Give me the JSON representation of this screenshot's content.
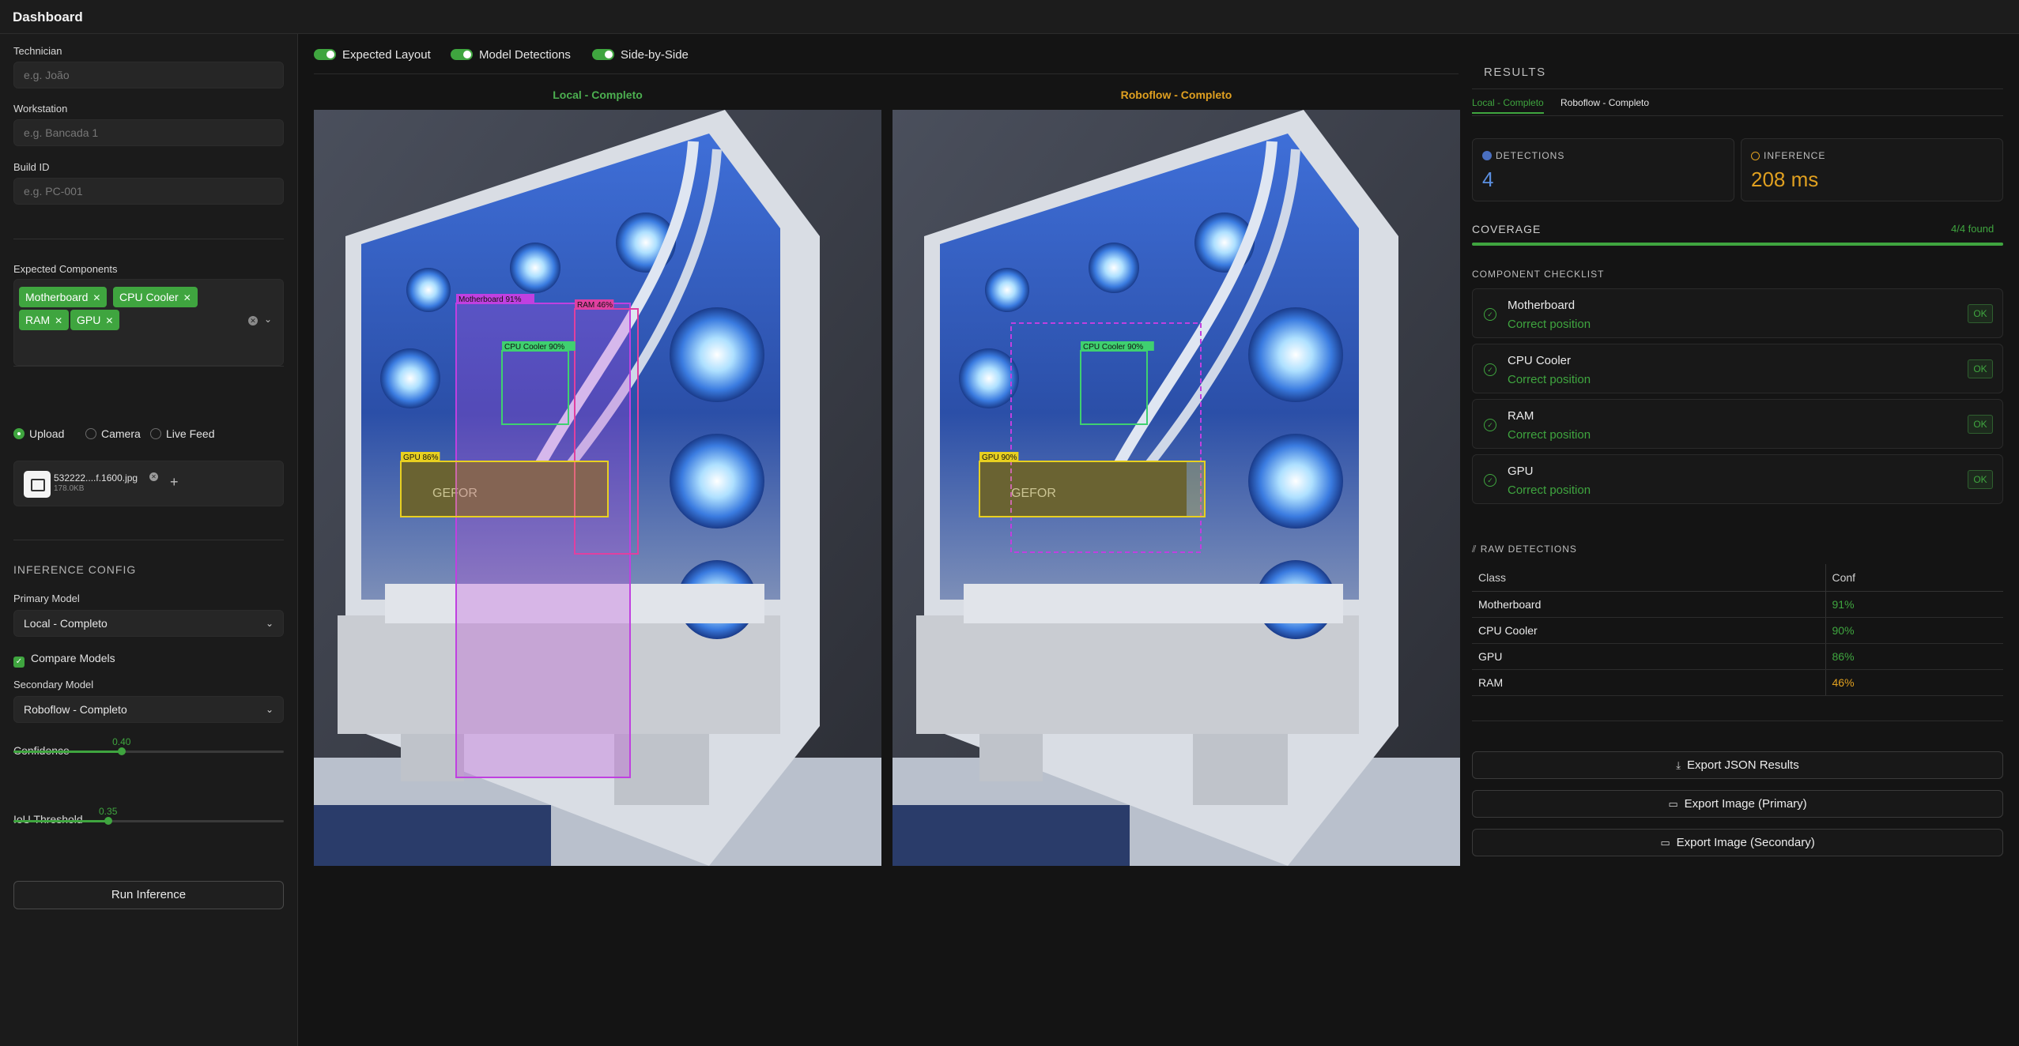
{
  "app": {
    "title": "Dashboard"
  },
  "sidebar": {
    "technician": {
      "label": "Technician",
      "placeholder": "e.g. João"
    },
    "workstation": {
      "label": "Workstation",
      "placeholder": "e.g. Bancada 1"
    },
    "build_id": {
      "label": "Build ID",
      "placeholder": "e.g. PC-001"
    },
    "expected_components": {
      "label": "Expected Components",
      "tags": [
        "Motherboard",
        "CPU Cooler",
        "RAM",
        "GPU"
      ]
    },
    "source": {
      "options": [
        "Upload",
        "Camera",
        "Live Feed"
      ],
      "selected": "Upload"
    },
    "file": {
      "name": "532222....f.1600.jpg",
      "size": "178.0KB"
    },
    "inference_config": {
      "heading": "INFERENCE CONFIG",
      "primary_model_label": "Primary Model",
      "primary_model": "Local - Completo",
      "compare_label": "Compare Models",
      "compare_checked": true,
      "secondary_model_label": "Secondary Model",
      "secondary_model": "Roboflow - Completo",
      "confidence_label": "Confidence",
      "confidence": "0.40",
      "iou_label": "IoU Threshold",
      "iou": "0.35"
    },
    "run_button": "Run Inference"
  },
  "main": {
    "toggles": [
      {
        "label": "Expected Layout",
        "on": true
      },
      {
        "label": "Model Detections",
        "on": true
      },
      {
        "label": "Side-by-Side",
        "on": true
      }
    ],
    "panels": [
      {
        "title": "Local - Completo",
        "title_color": "#4caf50",
        "boxes": [
          {
            "label": "Motherboard 91%",
            "color": "#c040e0"
          },
          {
            "label": "RAM 46%",
            "color": "#e040a0"
          },
          {
            "label": "CPU Cooler 90%",
            "color": "#3fd070"
          },
          {
            "label": "GPU 86%",
            "color": "#e8d020"
          }
        ]
      },
      {
        "title": "Roboflow - Completo",
        "title_color": "#e0a020",
        "boxes": [
          {
            "label": "CPU Cooler 90%",
            "color": "#3fd070"
          },
          {
            "label": "GPU 90%",
            "color": "#e8d020"
          }
        ]
      }
    ]
  },
  "results": {
    "heading": "RESULTS",
    "tabs": [
      "Local - Completo",
      "Roboflow - Completo"
    ],
    "active_tab": "Local - Completo",
    "detections": {
      "label": "DETECTIONS",
      "value": "4"
    },
    "inference": {
      "label": "INFERENCE",
      "value": "208 ms"
    },
    "coverage": {
      "label": "COVERAGE",
      "count": "4/4 found",
      "fraction": 1.0
    },
    "checklist": {
      "heading": "COMPONENT CHECKLIST",
      "items": [
        {
          "name": "Motherboard",
          "status": "Correct position",
          "badge": "OK"
        },
        {
          "name": "CPU Cooler",
          "status": "Correct position",
          "badge": "OK"
        },
        {
          "name": "RAM",
          "status": "Correct position",
          "badge": "OK"
        },
        {
          "name": "GPU",
          "status": "Correct position",
          "badge": "OK"
        }
      ]
    },
    "raw": {
      "heading": "RAW DETECTIONS",
      "columns": [
        "Class",
        "Conf"
      ],
      "rows": [
        {
          "class": "Motherboard",
          "conf": "91%"
        },
        {
          "class": "CPU Cooler",
          "conf": "90%"
        },
        {
          "class": "GPU",
          "conf": "86%"
        },
        {
          "class": "RAM",
          "conf": "46%"
        }
      ]
    },
    "exports": [
      "Export JSON Results",
      "Export Image (Primary)",
      "Export Image (Secondary)"
    ]
  },
  "colors": {
    "accent": "#3fa53f",
    "warning": "#e0a020",
    "detections_icon": "#4a6fc0",
    "inference_value": "#e0a020",
    "detections_value": "#5b8fe0"
  }
}
